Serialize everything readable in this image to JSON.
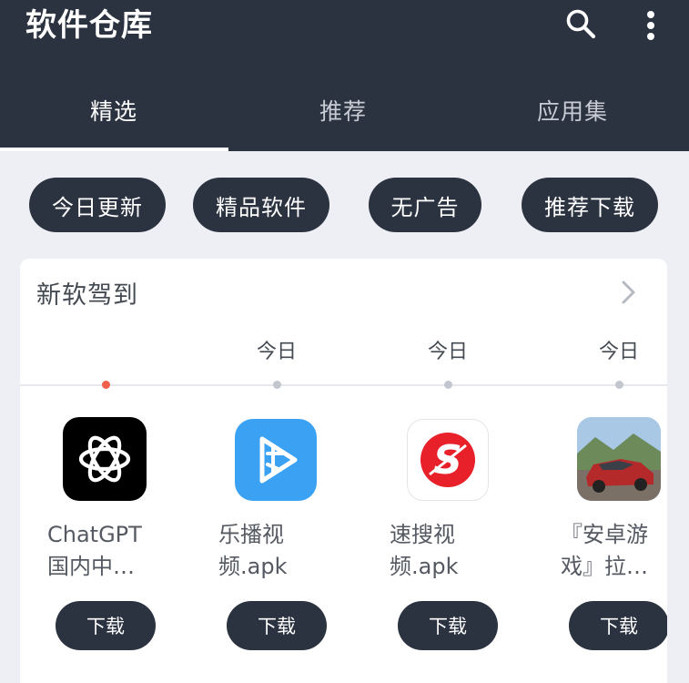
{
  "header": {
    "title": "软件仓库",
    "search_icon": "search-icon",
    "more_icon": "more-vertical-icon"
  },
  "tabs": [
    {
      "label": "精选",
      "active": true
    },
    {
      "label": "推荐",
      "active": false
    },
    {
      "label": "应用集",
      "active": false
    }
  ],
  "chips": [
    "今日更新",
    "精品软件",
    "无广告",
    "推荐下载"
  ],
  "section": {
    "title": "新软驾到",
    "more_icon": "chevron-right-icon",
    "dates": [
      "",
      "今日",
      "今日",
      "今日"
    ],
    "apps": [
      {
        "name_line1": "ChatGPT",
        "name_line2": "国内中…",
        "download": "下载",
        "icon": "openai-logo-icon"
      },
      {
        "name_line1": "乐播视",
        "name_line2": "频.apk",
        "download": "下载",
        "icon": "play-app-icon"
      },
      {
        "name_line1": "速搜视",
        "name_line2": "频.apk",
        "download": "下载",
        "icon": "s-logo-icon"
      },
      {
        "name_line1": "『安卓游",
        "name_line2": "戏』拉…",
        "download": "下载",
        "icon": "racing-game-icon"
      }
    ]
  },
  "colors": {
    "header_bg": "#2c3340",
    "page_bg": "#eeeff4",
    "timeline_current_dot": "#f0604a",
    "s_logo_red": "#e8202a",
    "play_blue": "#3ba1f3"
  }
}
